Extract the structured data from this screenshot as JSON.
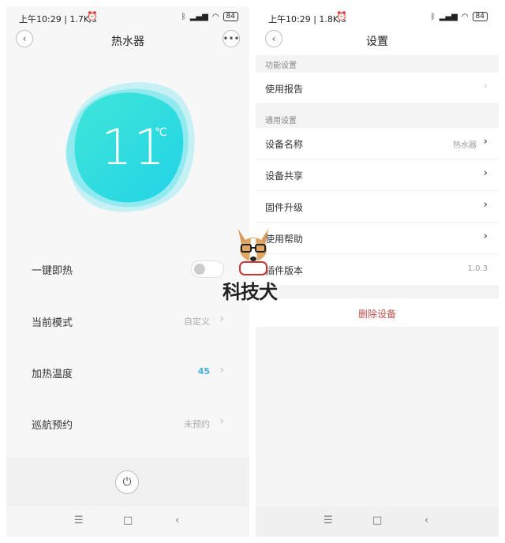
{
  "left": {
    "status": {
      "time": "上午10:29 | 1.7K/s",
      "battery": "84"
    },
    "title": "热水器",
    "temperature": {
      "value": "11",
      "unit": "℃"
    },
    "rows": [
      {
        "label": "一键即热",
        "value": ""
      },
      {
        "label": "当前模式",
        "value": "自定义"
      },
      {
        "label": "加热温度",
        "value": "45"
      },
      {
        "label": "巡航预约",
        "value": "未预约"
      }
    ],
    "quick_heat_on": false
  },
  "right": {
    "status": {
      "time": "上午10:29 | 1.8K/s",
      "battery": "84"
    },
    "title": "设置",
    "section1": {
      "header": "功能设置",
      "items": [
        {
          "label": "使用报告"
        }
      ]
    },
    "section2": {
      "header": "通用设置",
      "items": [
        {
          "label": "设备名称",
          "value": "热水器"
        },
        {
          "label": "设备共享",
          "value": ""
        },
        {
          "label": "固件升级",
          "value": ""
        },
        {
          "label": "使用帮助",
          "value": ""
        },
        {
          "label": "插件版本",
          "value": "1.0.3"
        }
      ]
    },
    "delete_label": "删除设备"
  },
  "watermark": {
    "text": "科技犬"
  },
  "colors": {
    "accent_blue": "#45b1d8",
    "delete_red": "#c0504d",
    "blob_cyan": "#2fe0e0"
  },
  "icons": [
    "back-arrow-icon",
    "more-dots-icon",
    "alarm-icon",
    "bluetooth-icon",
    "signal-icon",
    "wifi-icon",
    "battery-icon",
    "chevron-right-icon",
    "power-icon",
    "menu-nav-icon",
    "home-nav-icon",
    "back-nav-icon"
  ]
}
